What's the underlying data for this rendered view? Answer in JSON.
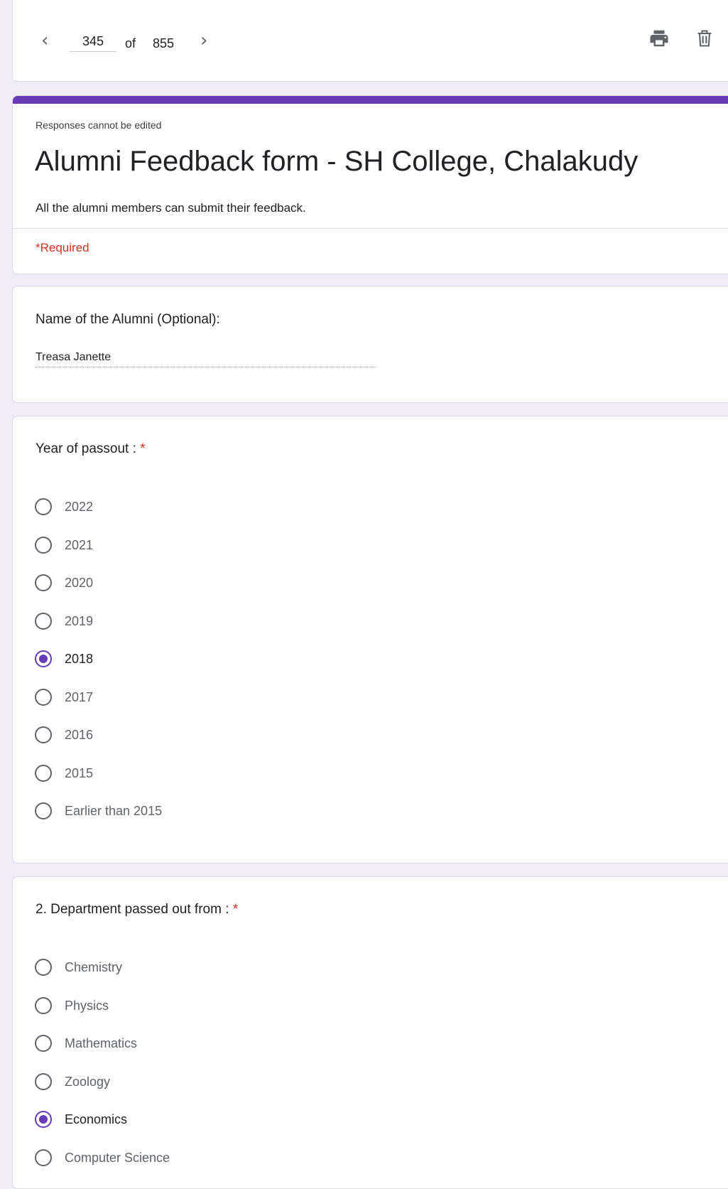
{
  "nav": {
    "current_page": "345",
    "of_label": "of",
    "total_pages": "855",
    "prev_icon": "chevron-left-icon",
    "next_icon": "chevron-right-icon",
    "print_icon": "print-icon",
    "delete_icon": "trash-icon"
  },
  "header": {
    "note": "Responses cannot be edited",
    "title": "Alumni Feedback form - SH College, Chalakudy",
    "description": "All the alumni members can submit their feedback.",
    "required_label": "*Required",
    "accent_color": "#673ab7"
  },
  "q_name": {
    "title": "Name of the Alumni (Optional):",
    "answer": "Treasa Janette"
  },
  "q_year": {
    "title": "Year of passout : ",
    "required_mark": "*",
    "options": [
      "2022",
      "2021",
      "2020",
      "2019",
      "2018",
      "2017",
      "2016",
      "2015",
      "Earlier than 2015"
    ],
    "selected": "2018"
  },
  "q_dept": {
    "title": "2. Department passed out from : ",
    "required_mark": "*",
    "options": [
      "Chemistry",
      "Physics",
      "Mathematics",
      "Zoology",
      "Economics",
      "Computer Science"
    ],
    "selected": "Economics"
  }
}
